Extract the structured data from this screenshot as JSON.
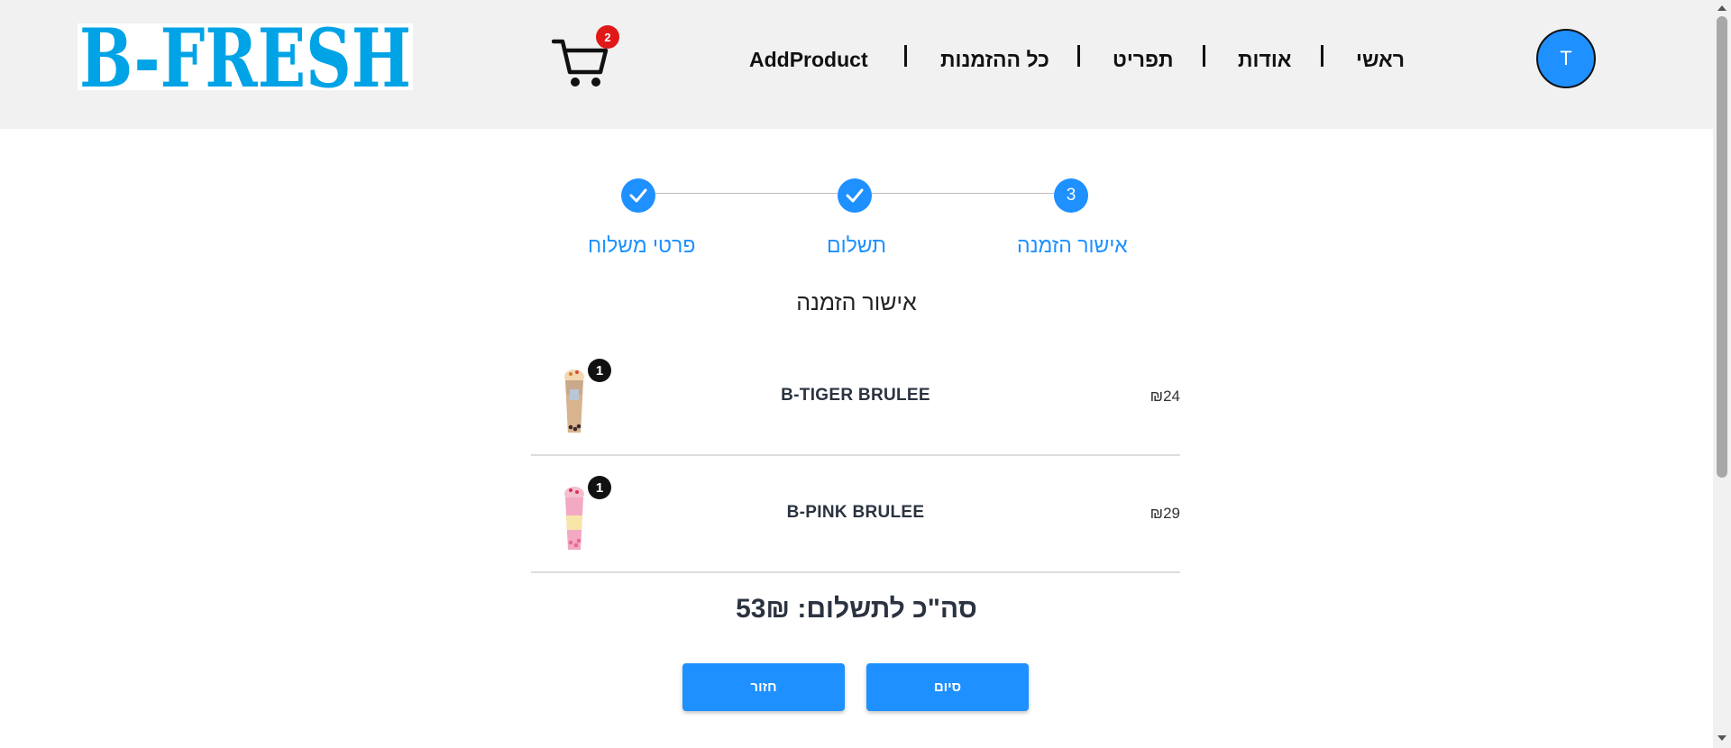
{
  "brand": {
    "logo_text": "B-FRESH",
    "color": "#00a3e6"
  },
  "cart": {
    "icon": "shopping-cart-icon",
    "count": "2"
  },
  "nav": {
    "items": [
      {
        "label": "ראשי"
      },
      {
        "label": "אודות"
      },
      {
        "label": "תפריט"
      },
      {
        "label": "כל ההזמנות"
      },
      {
        "label": "AddProduct"
      }
    ]
  },
  "user": {
    "avatar_initial": "T"
  },
  "stepper": {
    "steps": [
      {
        "label": "אישור הזמנה",
        "marker": "3",
        "state": "current"
      },
      {
        "label": "תשלום",
        "marker": "check-icon",
        "state": "completed"
      },
      {
        "label": "פרטי משלוח",
        "marker": "check-icon",
        "state": "completed"
      }
    ]
  },
  "section_title": "אישור הזמנה",
  "order": {
    "items": [
      {
        "name": "B-TIGER BRULEE",
        "price": "₪24",
        "quantity": "1"
      },
      {
        "name": "B-PINK BRULEE",
        "price": "₪29",
        "quantity": "1"
      }
    ],
    "total_label": "סה\"כ לתשלום: 53₪"
  },
  "buttons": {
    "finish": "סיום",
    "back": "חזור"
  },
  "colors": {
    "accent": "#1e90ff",
    "header_bg": "#f1f1f1",
    "badge": "#e01818"
  }
}
